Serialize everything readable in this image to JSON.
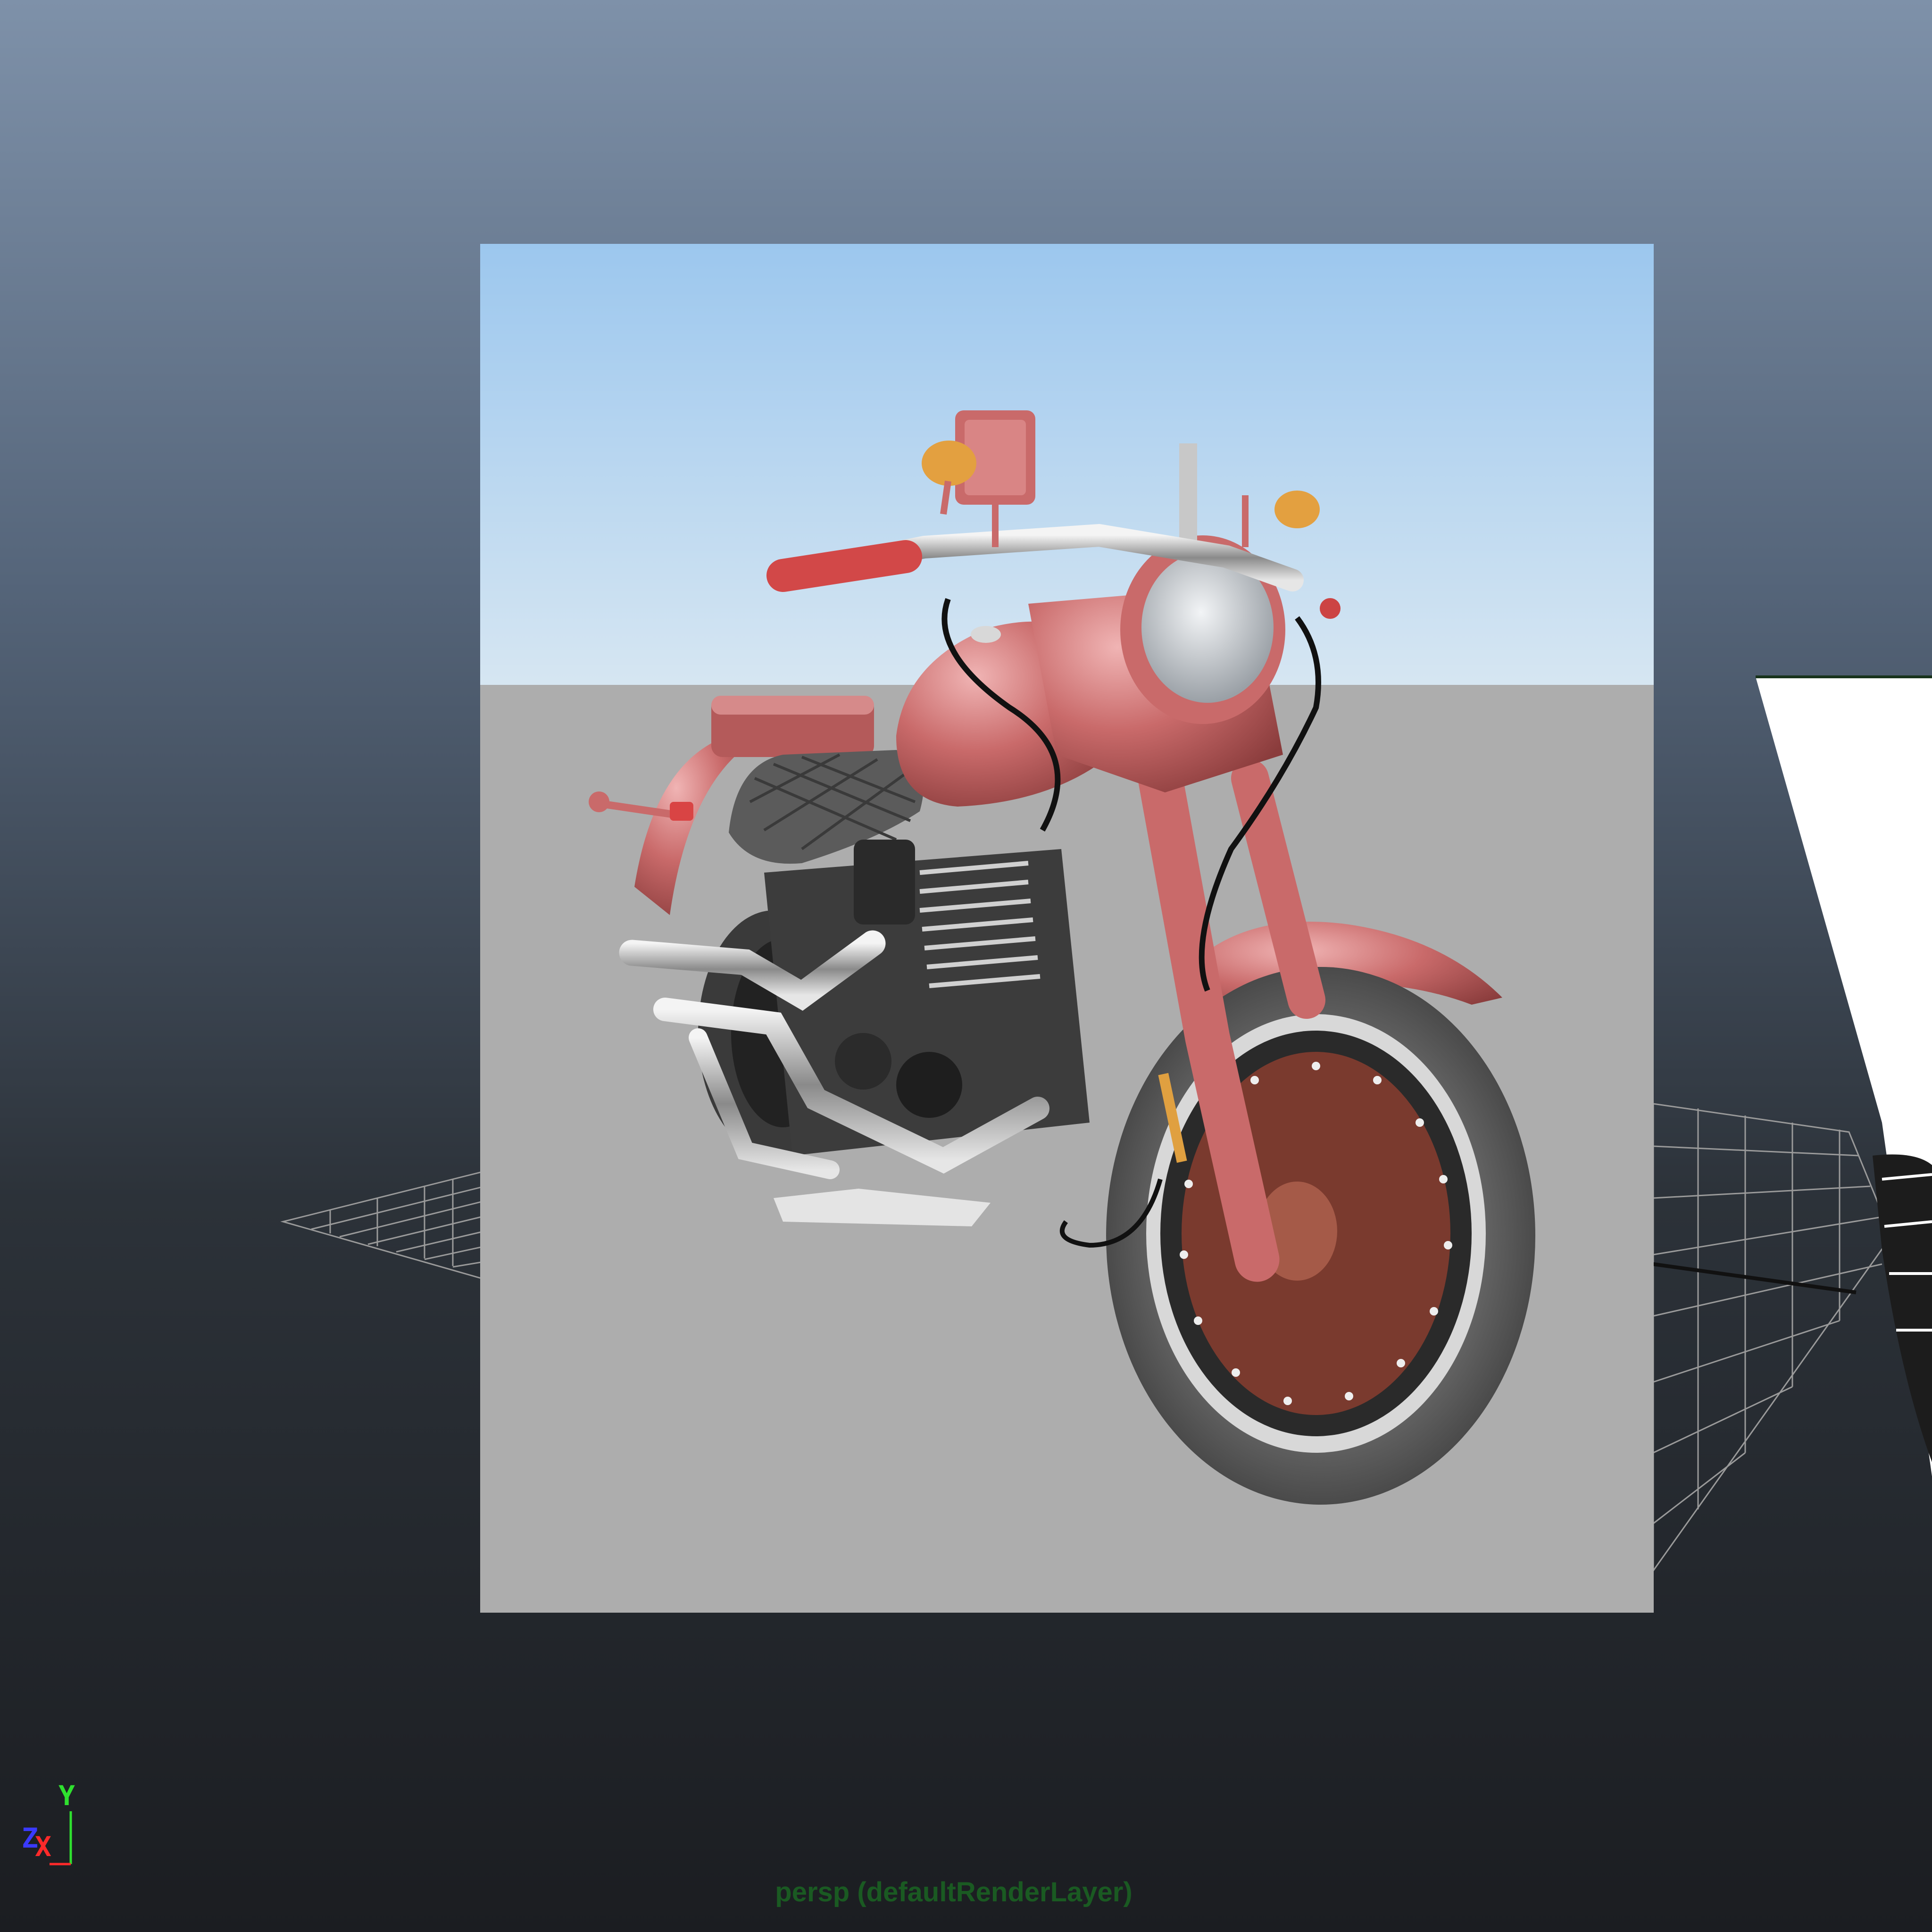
{
  "viewport": {
    "camera_label": "persp (defaultRenderLayer)",
    "axis_gizmo": {
      "y": "Y",
      "z": "Z",
      "x": "X"
    }
  },
  "colors": {
    "background_top": "#7e91a9",
    "background_bottom": "#1b1d21",
    "camera_label": "#1a5a22",
    "axis_y": "#2fe02f",
    "axis_z": "#3a3aff",
    "axis_x": "#ff2a2a",
    "motorcycle_body": "#c96a6a"
  }
}
